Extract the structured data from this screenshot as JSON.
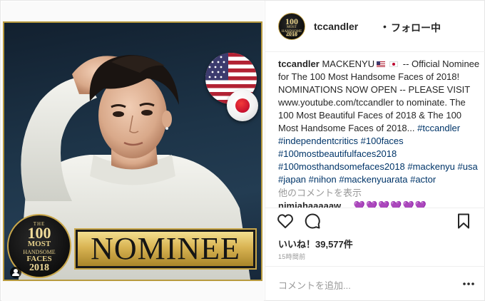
{
  "post": {
    "image": {
      "badge": {
        "the": "THE",
        "number": "100",
        "most": "MOST",
        "handsome": "HANDSOME",
        "faces": "FACES",
        "year": "2018"
      },
      "banner_text": "NOMINEE",
      "flags": [
        "us-flag-icon",
        "japan-flag-icon"
      ]
    },
    "header": {
      "avatar": {
        "number": "100",
        "middle": "MOST HANDSOME FACES",
        "year": "2018"
      },
      "username": "tccandler",
      "separator": "•",
      "follow_status": "フォロー中"
    },
    "caption": {
      "username": "tccandler",
      "lead": "MACKENYU",
      "flags": [
        "us-flag-icon",
        "japan-flag-icon"
      ],
      "text": " -- Official Nominee for The 100 Most Handsome Faces of 2018! NOMINATIONS NOW OPEN -- PLEASE VISIT www.youtube.com/tccandler to nominate. The 100 Most Beautiful Faces of 2018 & The 100 Most Handsome Faces of 2018... ",
      "hashtags": [
        "#tccandler",
        "#independentcritics",
        "#100faces",
        "#100mostbeautifulfaces2018",
        "#100mosthandsomefaces2018",
        "#mackenyu",
        "#usa",
        "#japan",
        "#nihon",
        "#mackenyuarata",
        "#actor"
      ]
    },
    "view_more_comments": "他のコメントを表示",
    "comment_preview": {
      "username": "nimiahaaaaaw",
      "text": "💜💜💜💜💜💜"
    },
    "likes": "いいね！39,577件",
    "timestamp": "15時間前",
    "comment_placeholder": "コメントを追加...",
    "colors": {
      "hashtag": "#003569",
      "gold": "#c9a74a",
      "muted": "#999999",
      "text": "#262626"
    },
    "icons": [
      "heart-icon",
      "comment-icon",
      "bookmark-icon",
      "more-options-icon",
      "user-tag-icon"
    ]
  }
}
